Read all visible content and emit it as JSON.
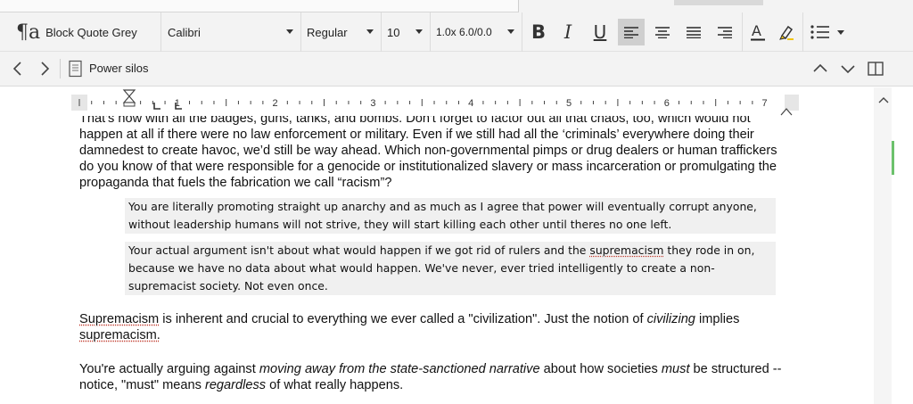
{
  "toolbar": {
    "style": "Block Quote Grey",
    "font": "Calibri",
    "weight": "Regular",
    "size": "10",
    "spacing": "1.0x 6.0/0.0",
    "bold": "B",
    "italic": "I",
    "underline": "U"
  },
  "nav": {
    "document_title": "Power silos"
  },
  "ruler": {
    "labels": [
      "1",
      "2",
      "3",
      "4",
      "5",
      "6",
      "7"
    ]
  },
  "document": {
    "p1": {
      "top_line": "That's how with all the badges, guns, tanks, and bombs. Don't forget to factor out all that chaos, too, which would not",
      "rest": "happen at all if there were no law enforcement or military. Even if we still had all the ‘criminals’ everywhere doing their damnedest to create havoc, we’d still be way ahead. Which non-governmental pimps or drug dealers or human traffickers do you know of that were responsible for a genocide or institutionalized slavery or mass incarceration or promulgating the propaganda that fuels the fabrication we call “racism”?"
    },
    "quote1": "You are literally promoting straight up anarchy and as much as I agree that power will eventually corrupt anyone, without leadership humans will not strive, they will start killing each other until theres no one left.",
    "quote2": {
      "a": "Your actual argument isn't about what would happen if we got rid of rulers and the ",
      "b": "supremacism",
      "c": " they rode in on, because we have no data about what would happen. We've never, ever tried intelligently to create a non-supremacist society. Not even once."
    },
    "p2": {
      "a": "Supremacism",
      "b": " is inherent and crucial to everything we ever called a \"civilization\". Just the notion of ",
      "c": "civilizing",
      "d": " implies ",
      "e": "supremacism."
    },
    "p3": {
      "a": "You're actually arguing against ",
      "b": "moving away from the state-sanctioned narrative",
      "c": " about how societies ",
      "d": "must",
      "e": " be structured -- notice, \"must\" means ",
      "f": "regardless",
      "g": " of what really happens."
    }
  },
  "colors": {
    "toolbar_bg": "#f3f3f3",
    "quote_bg": "#f0f0f0",
    "active_button": "#cfcfcf",
    "spell_underline": "#c0392b",
    "scroll_accent": "#6cc16c",
    "highlighter": "#f1c40f"
  }
}
